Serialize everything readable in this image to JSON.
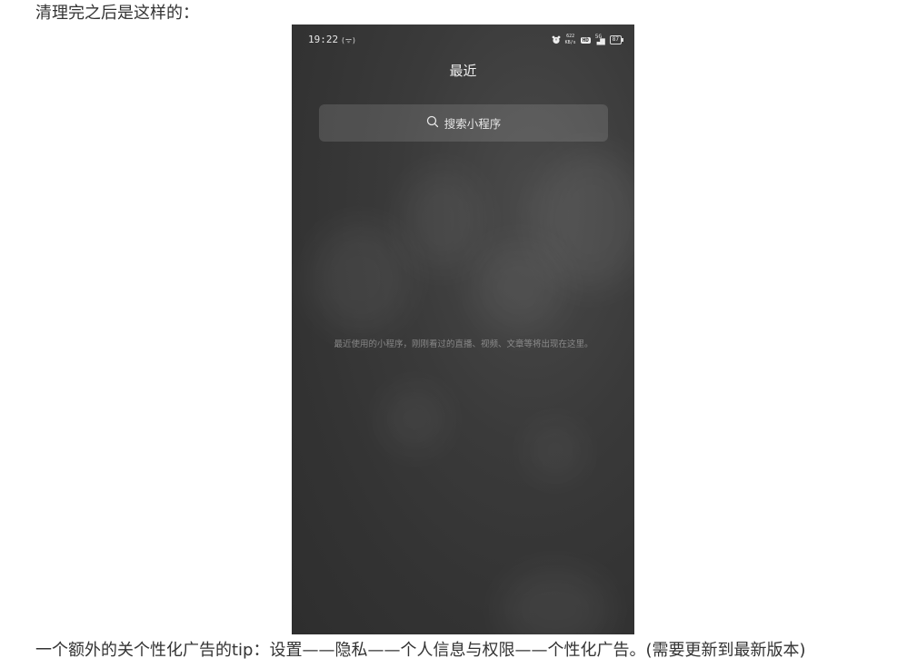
{
  "article": {
    "intro_text": "清理完之后是这样的：",
    "tip_text": "一个额外的关个性化广告的tip：设置——隐私——个人信息与权限——个性化广告。(需要更新到最新版本)"
  },
  "phone": {
    "status_bar": {
      "time": "19:22",
      "signal_icon": "wifi-calling-icon",
      "alarm_icon": "alarm-icon",
      "speed_value": "622",
      "speed_unit": "KB/s",
      "hd_badge": "HD",
      "network": "5G",
      "battery": "87"
    },
    "title": "最近",
    "search": {
      "icon": "search-icon",
      "placeholder": "搜索小程序"
    },
    "empty_message": "最近使用的小程序，刚刚看过的直播、视频、文章等将出现在这里。"
  },
  "colors": {
    "phone_background": "#333333",
    "search_bg": "rgba(255,255,255,0.13)",
    "page_background": "#ffffff"
  }
}
